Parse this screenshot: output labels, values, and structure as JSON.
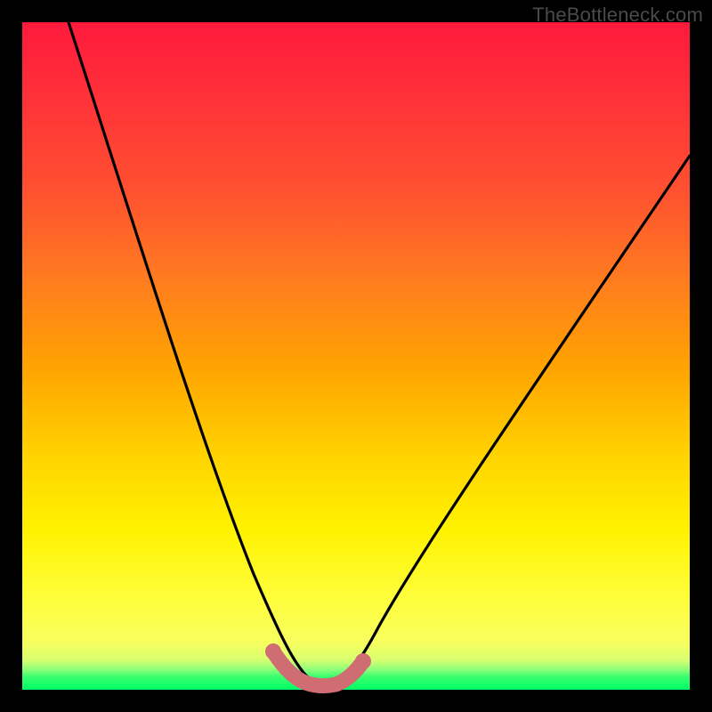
{
  "watermark": "TheBottleneck.com",
  "chart_data": {
    "type": "line",
    "title": "",
    "xlabel": "",
    "ylabel": "",
    "xlim": [
      0,
      100
    ],
    "ylim": [
      0,
      100
    ],
    "series": [
      {
        "name": "black-curve",
        "color": "#000000",
        "x": [
          7,
          10,
          15,
          20,
          25,
          30,
          35,
          38,
          40,
          42,
          44,
          46,
          48,
          50,
          55,
          60,
          65,
          70,
          75,
          80,
          85,
          90,
          95,
          100
        ],
        "values": [
          100,
          89,
          74,
          61,
          49,
          37,
          26,
          18,
          12,
          7,
          3,
          1,
          1,
          3,
          9,
          17,
          25,
          33,
          42,
          50,
          58,
          66,
          73,
          80
        ]
      },
      {
        "name": "pink-band",
        "color": "#cf6d72",
        "x": [
          38,
          40,
          42,
          44,
          46,
          48,
          50
        ],
        "values": [
          5,
          3,
          1.5,
          1,
          1.5,
          3,
          5
        ]
      }
    ],
    "gradient_stops": [
      {
        "pos": 0,
        "color": "#ff1a3c"
      },
      {
        "pos": 0.25,
        "color": "#ff7a20"
      },
      {
        "pos": 0.52,
        "color": "#ffa400"
      },
      {
        "pos": 0.76,
        "color": "#fff200"
      },
      {
        "pos": 0.95,
        "color": "#d8ff70"
      },
      {
        "pos": 1.0,
        "color": "#00ff66"
      }
    ]
  }
}
